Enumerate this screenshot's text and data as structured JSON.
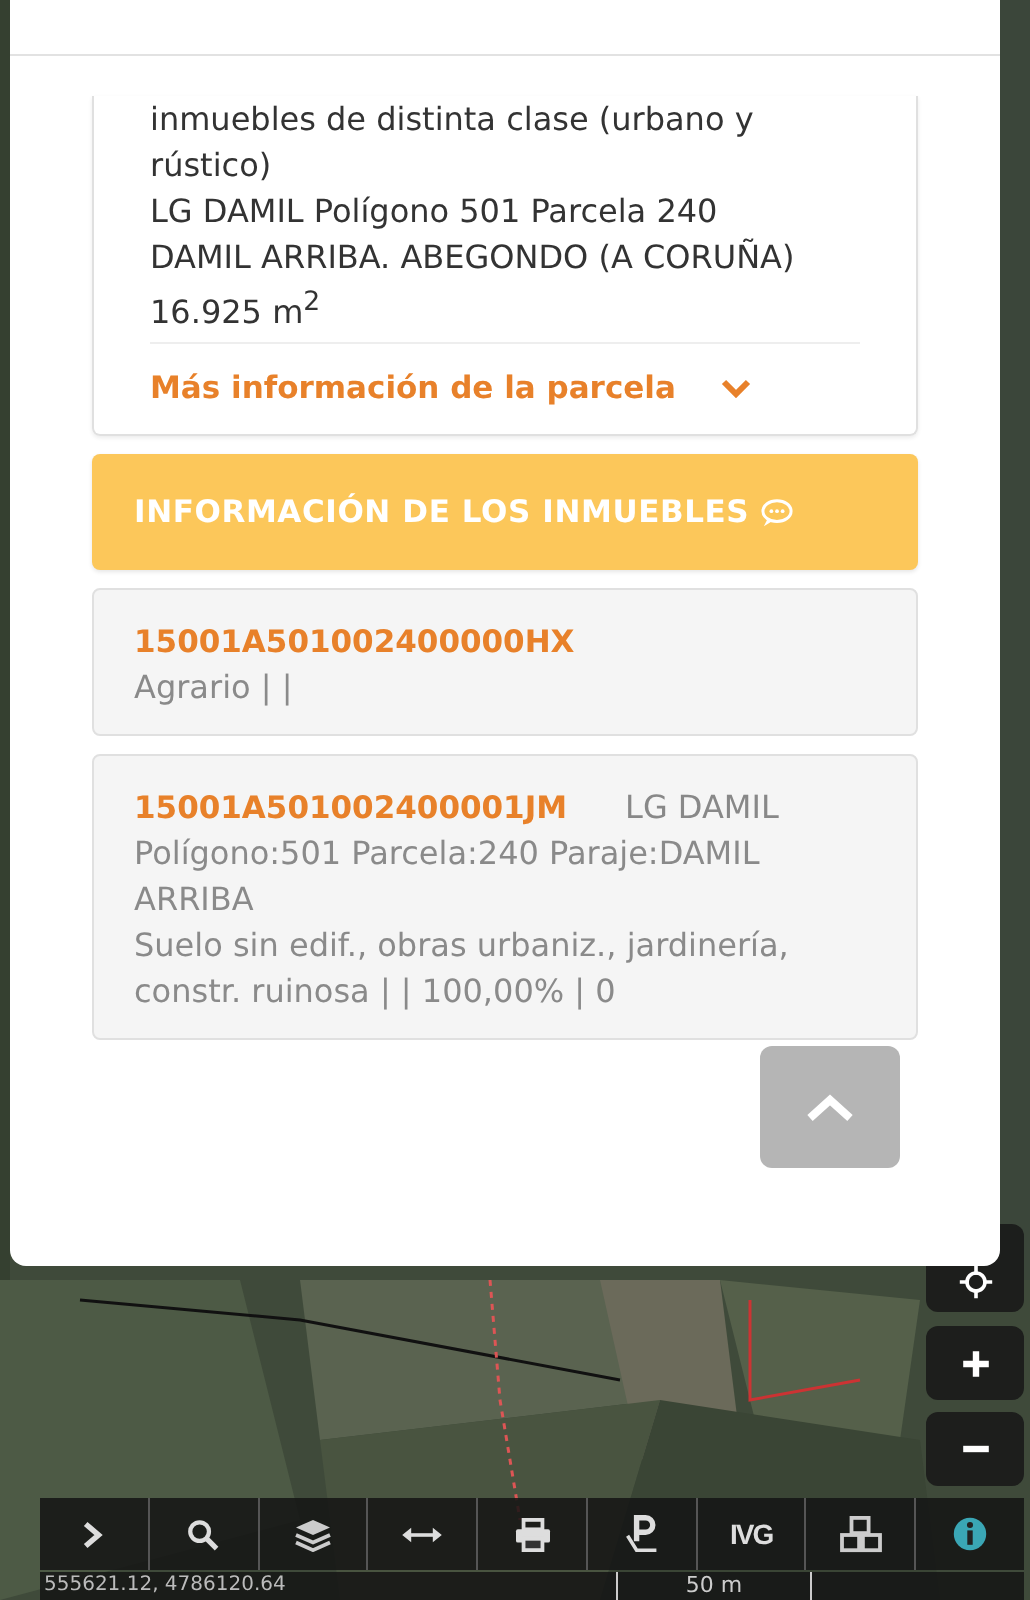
{
  "modal": {
    "parcel": {
      "description": "inmuebles de distinta clase (urbano y rústico)",
      "address": "LG DAMIL Polígono 501 Parcela 240",
      "locality": "DAMIL ARRIBA. ABEGONDO (A CORUÑA)",
      "area": "16.925 m$^{2}$"
    },
    "more_info": {
      "label": "Más información de la parcela",
      "expanded": false
    },
    "section_header": "INFORMACIÓN DE LOS INMUEBLES",
    "properties": [
      {
        "code": "15001A501002400000HX",
        "details": [
          "Agrario | |"
        ]
      },
      {
        "code": "15001A501002400001JM",
        "location": "LG DAMIL",
        "details": [
          "Polígono:501 Parcela:240 Paraje:DAMIL ARRIBA",
          "Suelo sin edif., obras urbaniz., jardinería, constr. ruinosa | | 100,00% | 0"
        ]
      }
    ]
  },
  "toolbar": [
    {
      "kind": "expand"
    },
    {
      "kind": "search"
    },
    {
      "kind": "layers"
    },
    {
      "kind": "measure"
    },
    {
      "kind": "print"
    },
    {
      "kind": "parking"
    },
    {
      "kind": "text",
      "label": "IVG"
    },
    {
      "kind": "cubes"
    },
    {
      "kind": "info"
    }
  ],
  "status_bar": {
    "coordinates": "555621.12, 4786120.64",
    "scale": "50 m"
  }
}
